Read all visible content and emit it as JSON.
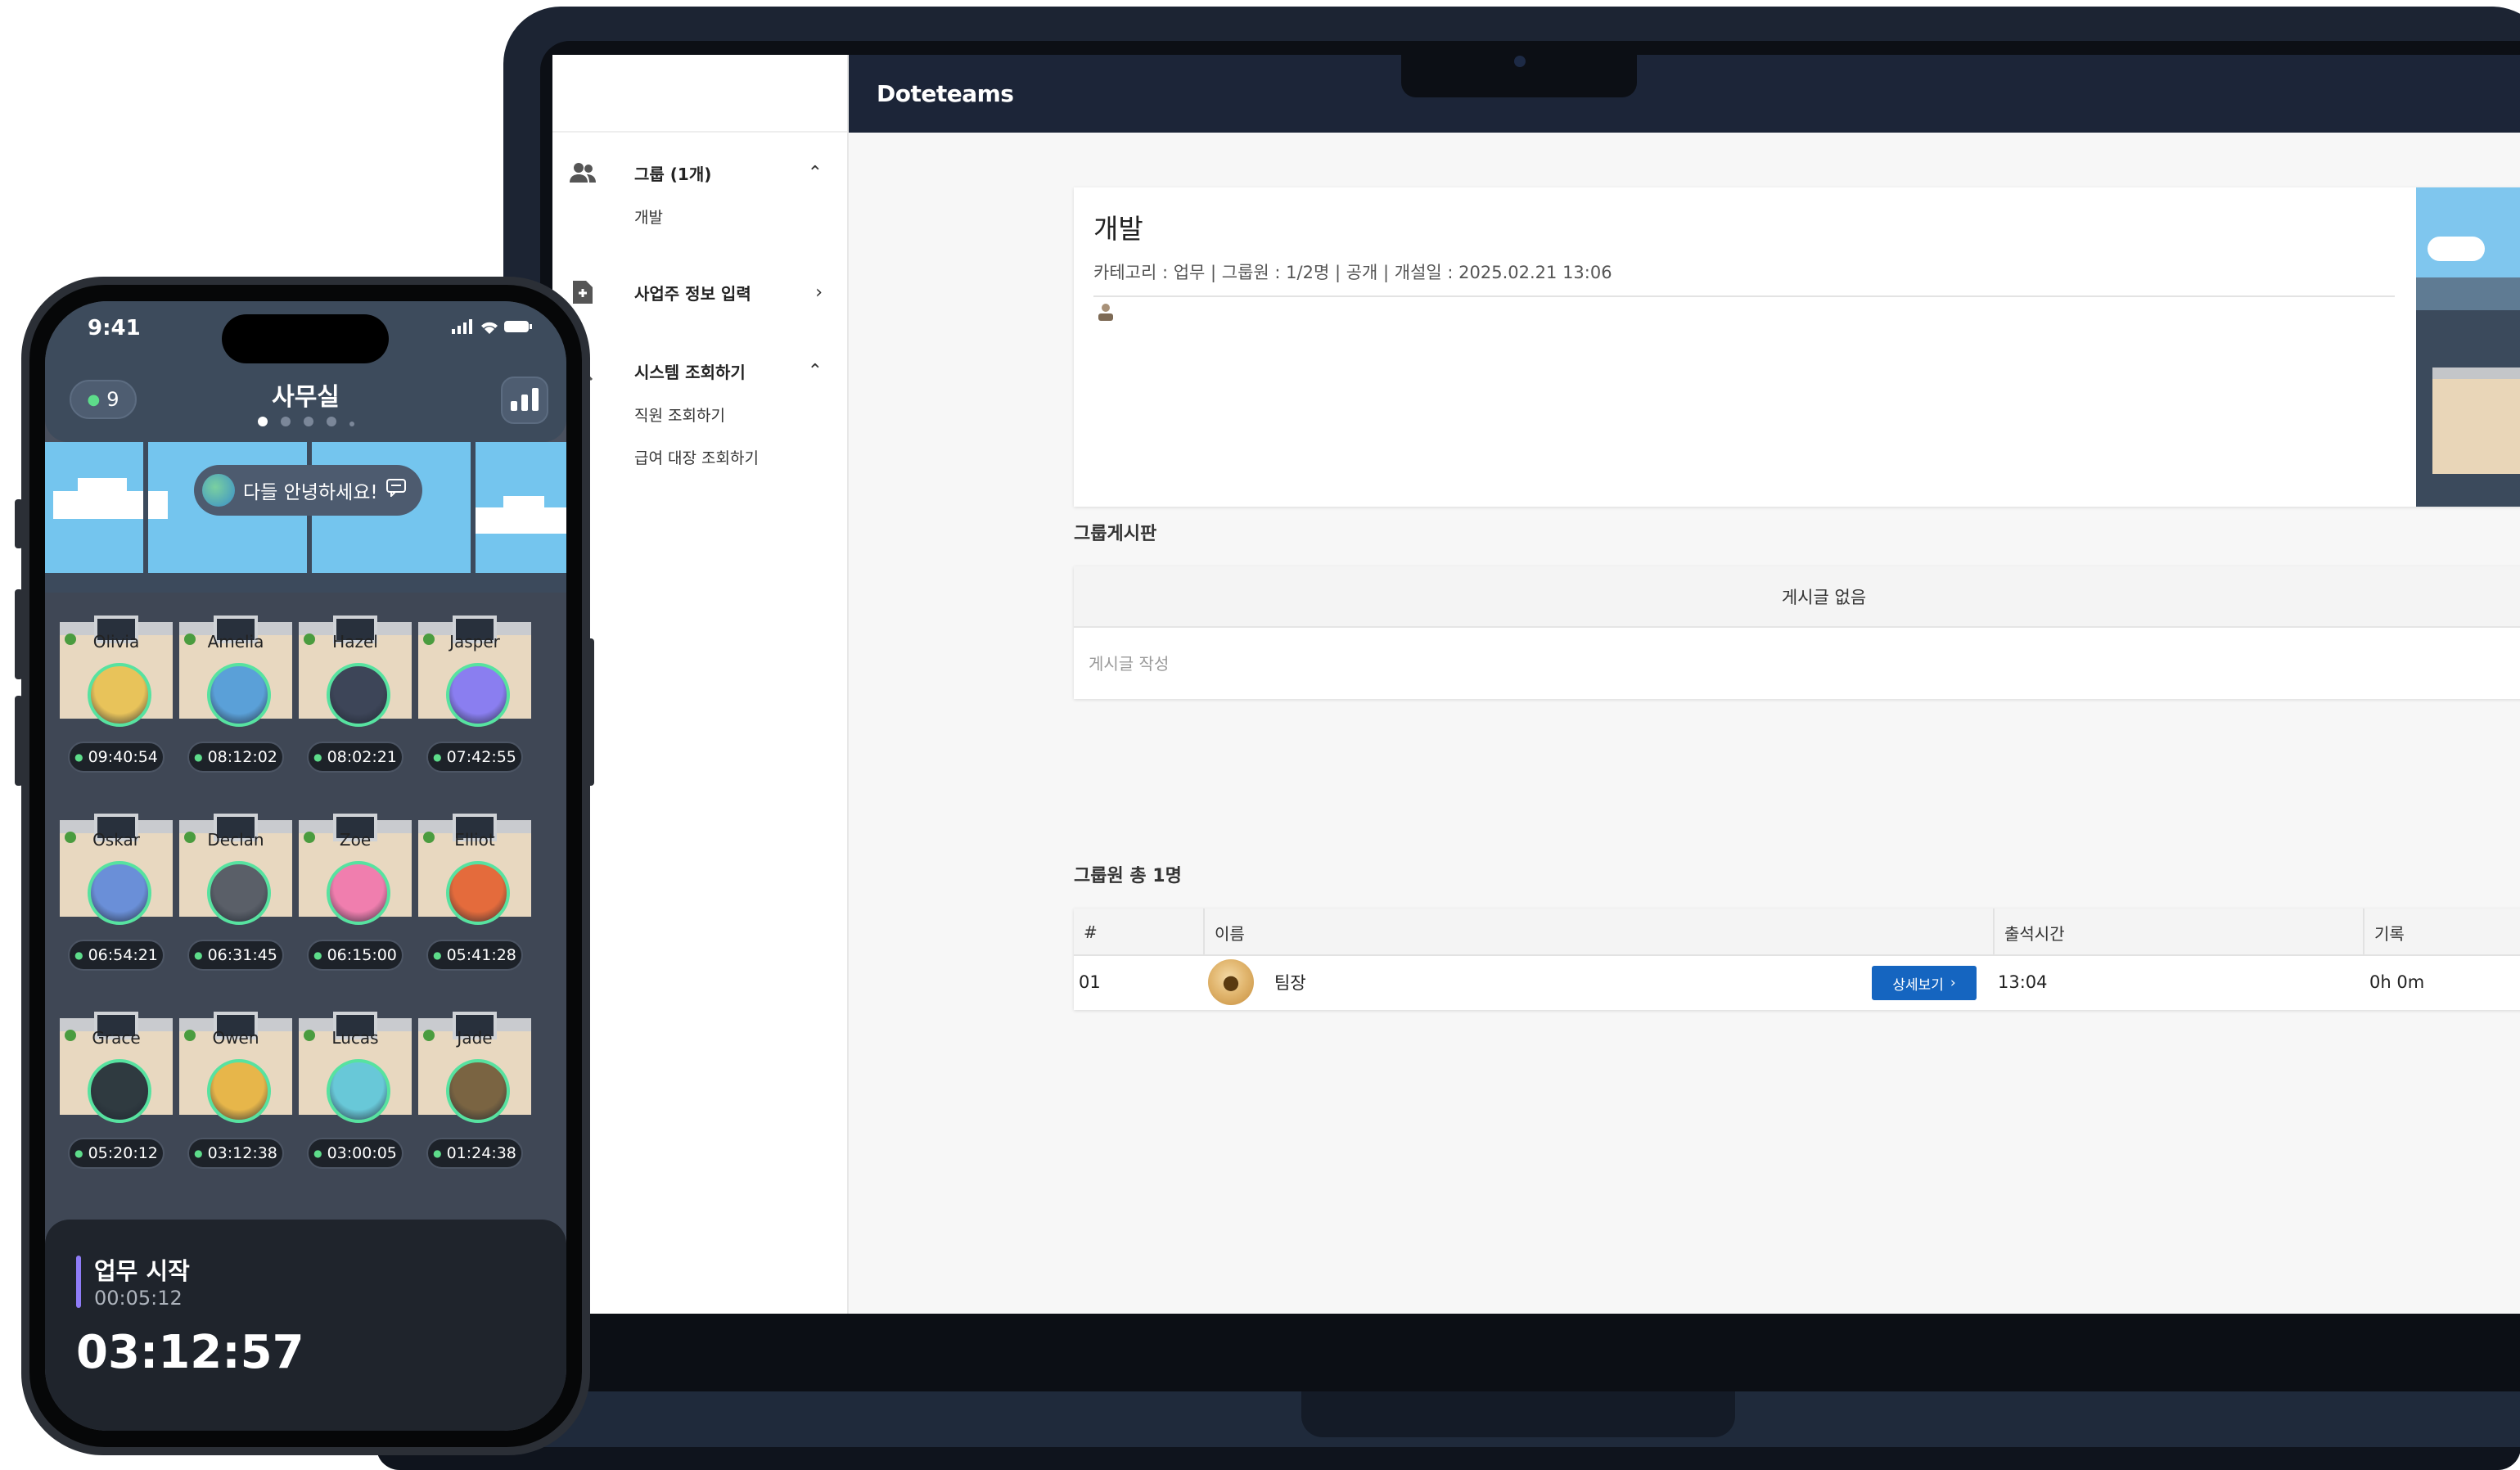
{
  "app": {
    "brand": "Doteteams"
  },
  "sidebar": {
    "sections": [
      {
        "title": "그룹 (1개)",
        "arrow": "⌃",
        "items": [
          "개발"
        ]
      },
      {
        "title": "사업주 정보 입력",
        "arrow": "›",
        "items": []
      },
      {
        "title": "시스템 조회하기",
        "arrow": "⌃",
        "items": [
          "직원 조회하기",
          "급여 대장 조회하기"
        ]
      }
    ]
  },
  "group": {
    "name": "개발",
    "meta": "카테고리 : 업무 | 그룹원 : 1/2명 | 공개 | 개설일 : 2025.02.21 13:06"
  },
  "board": {
    "heading": "그룹게시판",
    "empty": "게시글 없음",
    "write_placeholder": "게시글 작성"
  },
  "members": {
    "heading": "그룹원 총 1명",
    "columns": [
      "#",
      "이름",
      "출석시간",
      "기록"
    ],
    "rows": [
      {
        "num": "01",
        "name": "팀장",
        "detail_label": "상세보기",
        "attend": "13:04",
        "record": "0h 0m"
      }
    ]
  },
  "phone": {
    "time": "9:41",
    "user_count": "9",
    "room_title": "사무실",
    "bubble": "다들 안녕하세요!",
    "seats": [
      {
        "name": "Olivia",
        "time": "09:40:54",
        "color": "#e8c35a"
      },
      {
        "name": "Amelia",
        "time": "08:12:02",
        "color": "#5aa0d8"
      },
      {
        "name": "Hazel",
        "time": "08:02:21",
        "color": "#3d4558"
      },
      {
        "name": "Jasper",
        "time": "07:42:55",
        "color": "#8a7ef0"
      },
      {
        "name": "Oskar",
        "time": "06:54:21",
        "color": "#6a8fd8"
      },
      {
        "name": "Declan",
        "time": "06:31:45",
        "color": "#5a5f68"
      },
      {
        "name": "Zoe",
        "time": "06:15:00",
        "color": "#f07eae"
      },
      {
        "name": "Elliot",
        "time": "05:41:28",
        "color": "#e46b3c"
      },
      {
        "name": "Grace",
        "time": "05:20:12",
        "color": "#2f3a40"
      },
      {
        "name": "Owen",
        "time": "03:12:38",
        "color": "#e7b64a"
      },
      {
        "name": "Lucas",
        "time": "03:00:05",
        "color": "#68c8d8"
      },
      {
        "name": "Jade",
        "time": "01:24:38",
        "color": "#7a6442"
      }
    ],
    "task_label": "업무 시작",
    "task_elapsed": "00:05:12",
    "total_time": "03:12:57"
  }
}
